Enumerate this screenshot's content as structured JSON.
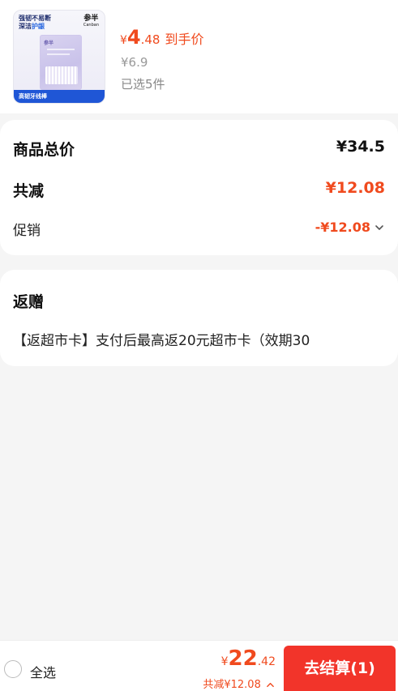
{
  "product": {
    "thumbnail": {
      "slogan_line1": "强韧不易断",
      "slogan_line2": "深洁",
      "slogan_highlight": "护龈",
      "brand_cn": "参半",
      "brand_en": "Canban",
      "pack_text": "参半",
      "bottom_text": "高韧牙线棒"
    },
    "price_symbol": "¥",
    "price_int": "4",
    "price_dec": ".48",
    "price_tag": "到手价",
    "original_price": "¥6.9",
    "selected_text": "已选5件"
  },
  "summary": {
    "total_label": "商品总价",
    "total_value": "¥34.5",
    "reduce_label": "共减",
    "reduce_value": "¥12.08",
    "promo_label": "促销",
    "promo_value": "-¥12.08"
  },
  "gift": {
    "title": "返赠",
    "text": "【返超市卡】支付后最高返20元超市卡（效期30"
  },
  "bottom": {
    "select_all": "全选",
    "total_symbol": "¥",
    "total_int": "22",
    "total_dec": ".42",
    "discount_text": "共减¥12.08",
    "checkout_label": "去结算(1)"
  },
  "colors": {
    "accent": "#f04a1e",
    "checkout_bg": "#f2342a",
    "page_bg": "#f5f5f5"
  }
}
